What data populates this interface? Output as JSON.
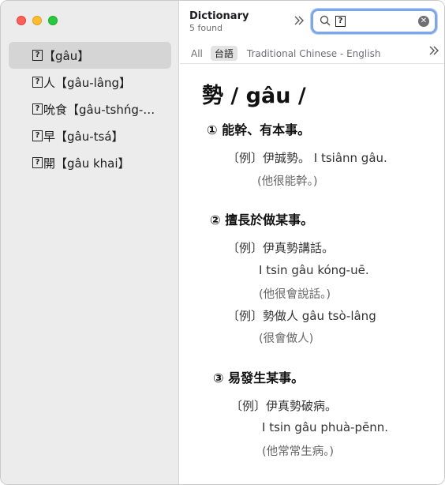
{
  "sidebar": {
    "items": [
      {
        "label": "【gâu】",
        "selected": true
      },
      {
        "label": "人【gâu-lâng】",
        "selected": false
      },
      {
        "label": "吮食【gâu-tshńg-…",
        "selected": false
      },
      {
        "label": "早【gâu-tsá】",
        "selected": false
      },
      {
        "label": "開【gâu khai】",
        "selected": false
      }
    ]
  },
  "toolbar": {
    "title": "Dictionary",
    "count": "5 found",
    "search_icon": "search-icon",
    "clear_icon": "clear-icon"
  },
  "tabs": [
    {
      "label": "All",
      "active": false
    },
    {
      "label": "台語",
      "active": true
    },
    {
      "label": "Traditional Chinese - English",
      "active": false
    }
  ],
  "entry": {
    "headword": "勢 / gâu /",
    "senses": [
      {
        "heading": "① 能幹、有本事。",
        "example_1": "〔例〕伊誠勢。  I tsiânn gâu.",
        "gloss_1": "(他很能幹。)"
      },
      {
        "heading": "② 擅長於做某事。",
        "example_1": "〔例〕伊真勢講話。",
        "romanization_1": "I tsin gâu kóng-uē.",
        "gloss_1": "(他很會說話。)",
        "example_2": "〔例〕勢做人  gâu tsò-lâng",
        "gloss_2": "(很會做人)"
      },
      {
        "heading": "③ 易發生某事。",
        "example_1": "〔例〕伊真勢破病。",
        "romanization_1": "I tsin gâu phuà-pēnn.",
        "gloss_1": "(他常常生病。)"
      }
    ]
  },
  "colors": {
    "sidebar_bg": "#ececec",
    "selection_bg": "#d5d5d5",
    "search_focus": "#7fa6e8"
  }
}
